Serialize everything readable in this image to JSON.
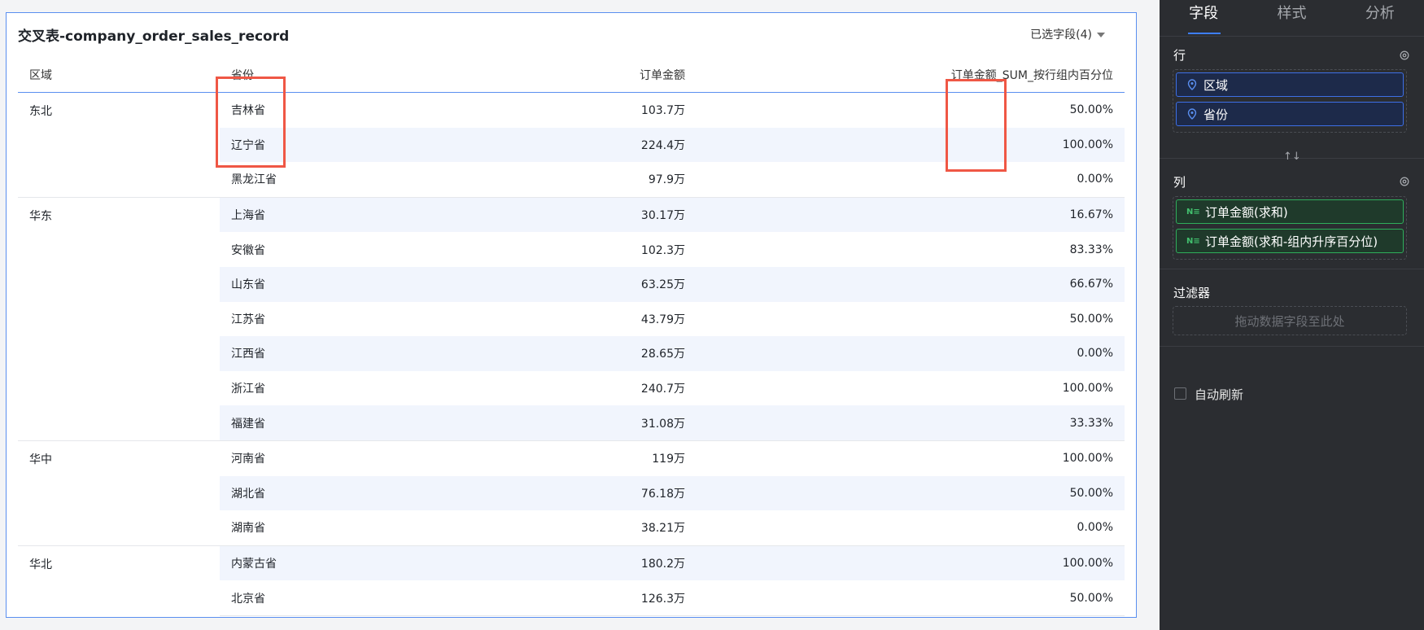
{
  "table": {
    "title": "交叉表-company_order_sales_record",
    "selected_fields": "已选字段(4)",
    "headers": [
      "区域",
      "省份",
      "订单金额",
      "订单金额_SUM_按行组内百分位"
    ],
    "groups": [
      {
        "region": "东北",
        "rows": [
          [
            "吉林省",
            "103.7万",
            "50.00%"
          ],
          [
            "辽宁省",
            "224.4万",
            "100.00%"
          ],
          [
            "黑龙江省",
            "97.9万",
            "0.00%"
          ]
        ]
      },
      {
        "region": "华东",
        "rows": [
          [
            "上海省",
            "30.17万",
            "16.67%"
          ],
          [
            "安徽省",
            "102.3万",
            "83.33%"
          ],
          [
            "山东省",
            "63.25万",
            "66.67%"
          ],
          [
            "江苏省",
            "43.79万",
            "50.00%"
          ],
          [
            "江西省",
            "28.65万",
            "0.00%"
          ],
          [
            "浙江省",
            "240.7万",
            "100.00%"
          ],
          [
            "福建省",
            "31.08万",
            "33.33%"
          ]
        ]
      },
      {
        "region": "华中",
        "rows": [
          [
            "河南省",
            "119万",
            "100.00%"
          ],
          [
            "湖北省",
            "76.18万",
            "50.00%"
          ],
          [
            "湖南省",
            "38.21万",
            "0.00%"
          ]
        ]
      },
      {
        "region": "华北",
        "rows": [
          [
            "内蒙古省",
            "180.2万",
            "100.00%"
          ],
          [
            "北京省",
            "126.3万",
            "50.00%"
          ]
        ]
      }
    ]
  },
  "sidebar": {
    "tabs": [
      "字段",
      "样式",
      "分析"
    ],
    "active_tab": "字段",
    "rows_title": "行",
    "row_fields": [
      "区域",
      "省份"
    ],
    "swap_icon": "↑↓",
    "cols_title": "列",
    "measure_badge": "N≡",
    "col_fields": [
      "订单金额(求和)",
      "订单金额(求和-组内升序百分位)"
    ],
    "filter_title": "过滤器",
    "filter_hint": "拖动数据字段至此处",
    "auto_refresh": "自动刷新"
  },
  "colors": {
    "accent": "#3d7eff",
    "highlight_box": "#ef5745",
    "stripe": "#f1f5fd",
    "measure": "#2fae5b"
  }
}
